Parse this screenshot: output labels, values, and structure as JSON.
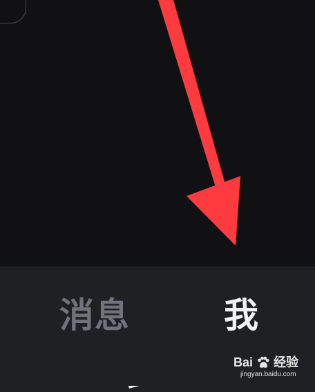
{
  "tabs": [
    {
      "label": "消息",
      "state": "inactive"
    },
    {
      "label": "我",
      "state": "active"
    }
  ],
  "watermark": {
    "brand": "Bai",
    "brand_suffix": "经验",
    "url": "jingyan.baidu.com"
  },
  "colors": {
    "background": "#111113",
    "tab_bar": "#1f2023",
    "inactive_tab": "#6f737a",
    "active_tab": "#f2f2f2",
    "arrow": "#ff3b3f"
  },
  "icons": {
    "annotation": "red-arrow-icon",
    "watermark_logo": "paw-icon"
  }
}
